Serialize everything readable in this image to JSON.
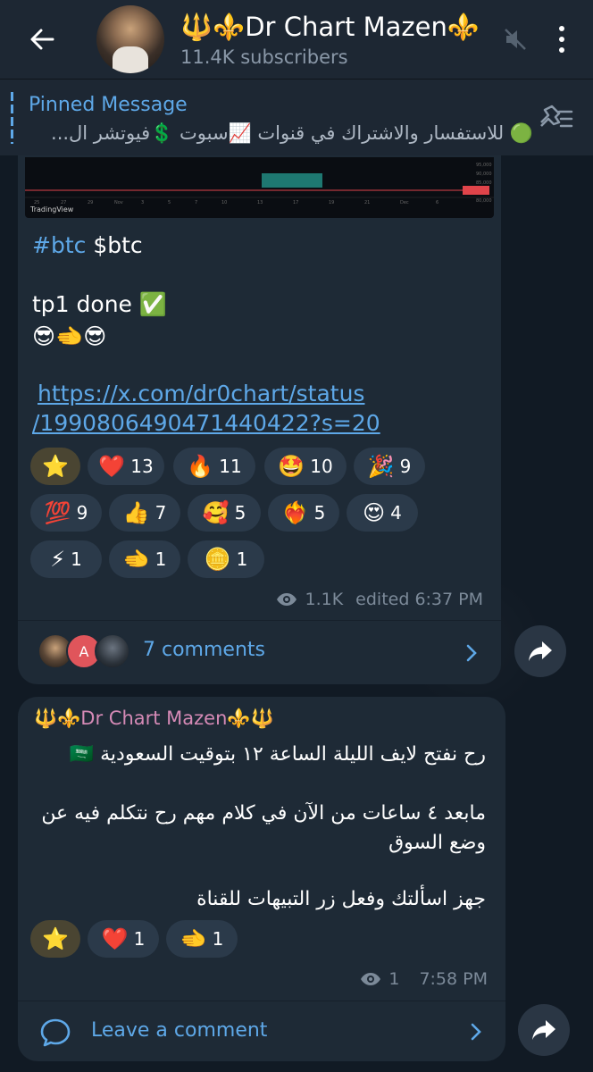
{
  "header": {
    "title": "🔱⚜️Dr Chart Mazen⚜️🔱",
    "subscribers": "11.4K subscribers"
  },
  "pinned": {
    "label": "Pinned Message",
    "text": "🟢 للاستفسار والاشتراك في قنوات 📈سبوت 💲فيوتشر  ال..."
  },
  "post1": {
    "hashtag": "#btc",
    "cashtag": "$btc",
    "line2": "tp1 done ✅",
    "line3": "😎🫲😎",
    "link_part1": "https://x.com/dr0chart/status",
    "link_part2": "/1990806490471440422?s=20",
    "reactions": [
      {
        "emoji": "⭐",
        "count": ""
      },
      {
        "emoji": "❤️",
        "count": "13"
      },
      {
        "emoji": "🔥",
        "count": "11"
      },
      {
        "emoji": "🤩",
        "count": "10"
      },
      {
        "emoji": "🎉",
        "count": "9"
      },
      {
        "emoji": "💯",
        "count": "9"
      },
      {
        "emoji": "👍",
        "count": "7"
      },
      {
        "emoji": "🥰",
        "count": "5"
      },
      {
        "emoji": "❤️‍🔥",
        "count": "5"
      },
      {
        "emoji": "😍",
        "count": "4"
      },
      {
        "emoji": "⚡",
        "count": "1"
      },
      {
        "emoji": "🫲",
        "count": "1"
      },
      {
        "emoji": "🪙",
        "count": "1"
      }
    ],
    "views": "1.1K",
    "edited_time": "edited 6:37 PM",
    "comments_label": "7 comments",
    "commenter_initial": "A"
  },
  "post2": {
    "sender": "🔱⚜️Dr Chart Mazen⚜️🔱",
    "line1": "رح نفتح لايف الليلة الساعة ١٢ بتوقيت السعودية 🇸🇦",
    "line2": "مابعد ٤ ساعات من الآن في كلام مهم رح نتكلم فيه عن وضع السوق",
    "line3": "جهز اسألتك وفعل زر التبيهات للقناة",
    "reactions": [
      {
        "emoji": "⭐",
        "count": ""
      },
      {
        "emoji": "❤️",
        "count": "1"
      },
      {
        "emoji": "🫲",
        "count": "1"
      }
    ],
    "views": "1",
    "time": "7:58 PM",
    "comment_label": "Leave a comment"
  },
  "chart_thumb": {
    "watermark": "TradingView"
  },
  "colors": {
    "accent": "#5ea8e8",
    "bubble": "#1e2a36",
    "header": "#1d2733",
    "sender": "#d58ab6"
  }
}
